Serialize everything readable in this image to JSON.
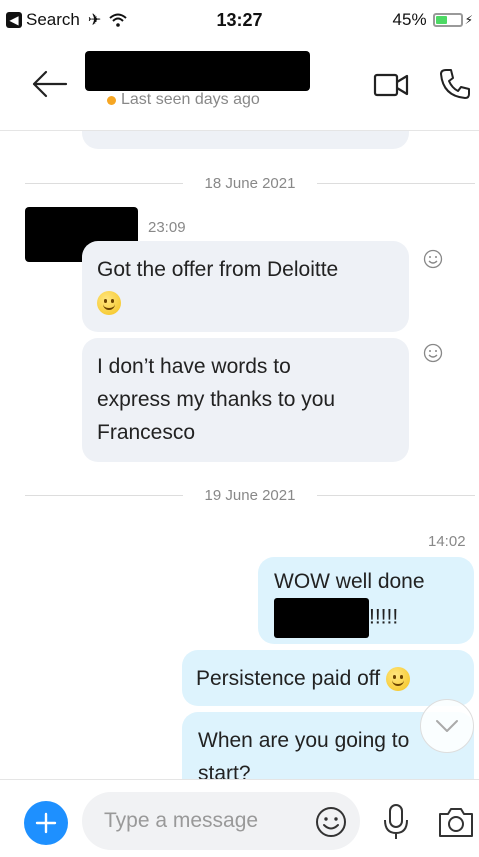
{
  "status_bar": {
    "back_app": "Search",
    "time": "13:27",
    "battery": "45%",
    "battery_level": 0.45
  },
  "header": {
    "last_seen": "Last seen days ago",
    "status_color": "#f6a623"
  },
  "chat": {
    "messages": [
      {
        "date": "18 June 2021"
      },
      {
        "time": "23:09"
      },
      {
        "text": "Got the offer from Deloitte"
      },
      {
        "text": "I don’t have words to express my thanks to you Francesco",
        "lines": [
          "I don’t have words to",
          "express my thanks to you",
          "Francesco"
        ]
      },
      {
        "date": "19 June 2021"
      },
      {
        "time": "14:02"
      },
      {
        "text_before": "WOW well done",
        "text_after": "!!!!!"
      },
      {
        "text": "Persistence paid off"
      },
      {
        "text": "When are you going to start?",
        "lines": [
          "When are you going to",
          "start?"
        ]
      }
    ]
  },
  "composer": {
    "placeholder": "Type a message"
  },
  "colors": {
    "accent": "#1e90ff",
    "incoming_bubble": "#eef1f6",
    "outgoing_bubble": "#ddf3fd"
  }
}
